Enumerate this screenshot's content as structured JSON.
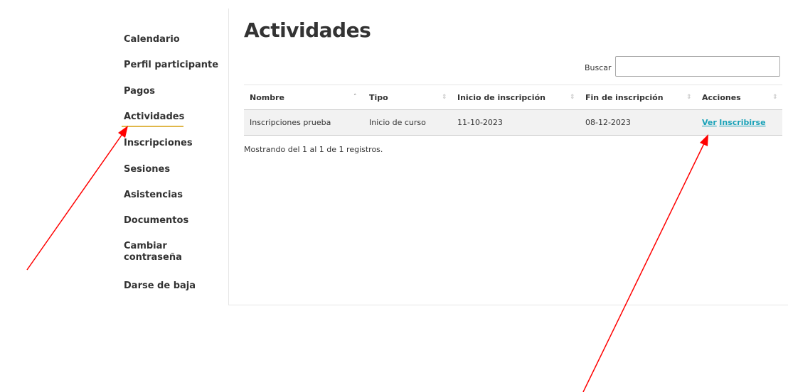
{
  "sidebar": {
    "items": [
      {
        "label": "Calendario"
      },
      {
        "label": "Perfil participante"
      },
      {
        "label": "Pagos"
      },
      {
        "label": "Actividades",
        "active": true
      },
      {
        "label": "Inscripciones"
      },
      {
        "label": "Sesiones"
      },
      {
        "label": "Asistencias"
      },
      {
        "label": "Documentos"
      },
      {
        "label": "Cambiar contraseña"
      },
      {
        "label": "Darse de baja"
      }
    ],
    "cambiar_line1": "Cambiar",
    "cambiar_line2": "contraseña"
  },
  "main": {
    "title": "Actividades",
    "search": {
      "label": "Buscar",
      "value": "",
      "placeholder": ""
    },
    "table": {
      "columns": [
        "Nombre",
        "Tipo",
        "Inicio de inscripción",
        "Fin de inscripción",
        "Acciones"
      ],
      "rows": [
        {
          "nombre": "Inscripciones prueba",
          "tipo": "Inicio de curso",
          "inicio": "11-10-2023",
          "fin": "08-12-2023",
          "acciones": [
            "Ver",
            "Inscribirse"
          ]
        }
      ]
    },
    "info": "Mostrando del 1 al 1 de 1 registros."
  },
  "colors": {
    "accent_underline": "#e0b74a",
    "link": "#1aa2b8",
    "annotation_arrow": "#ff0000"
  },
  "icons": {
    "sort": "sort-icon",
    "sort_asc": "sort-asc-icon"
  }
}
